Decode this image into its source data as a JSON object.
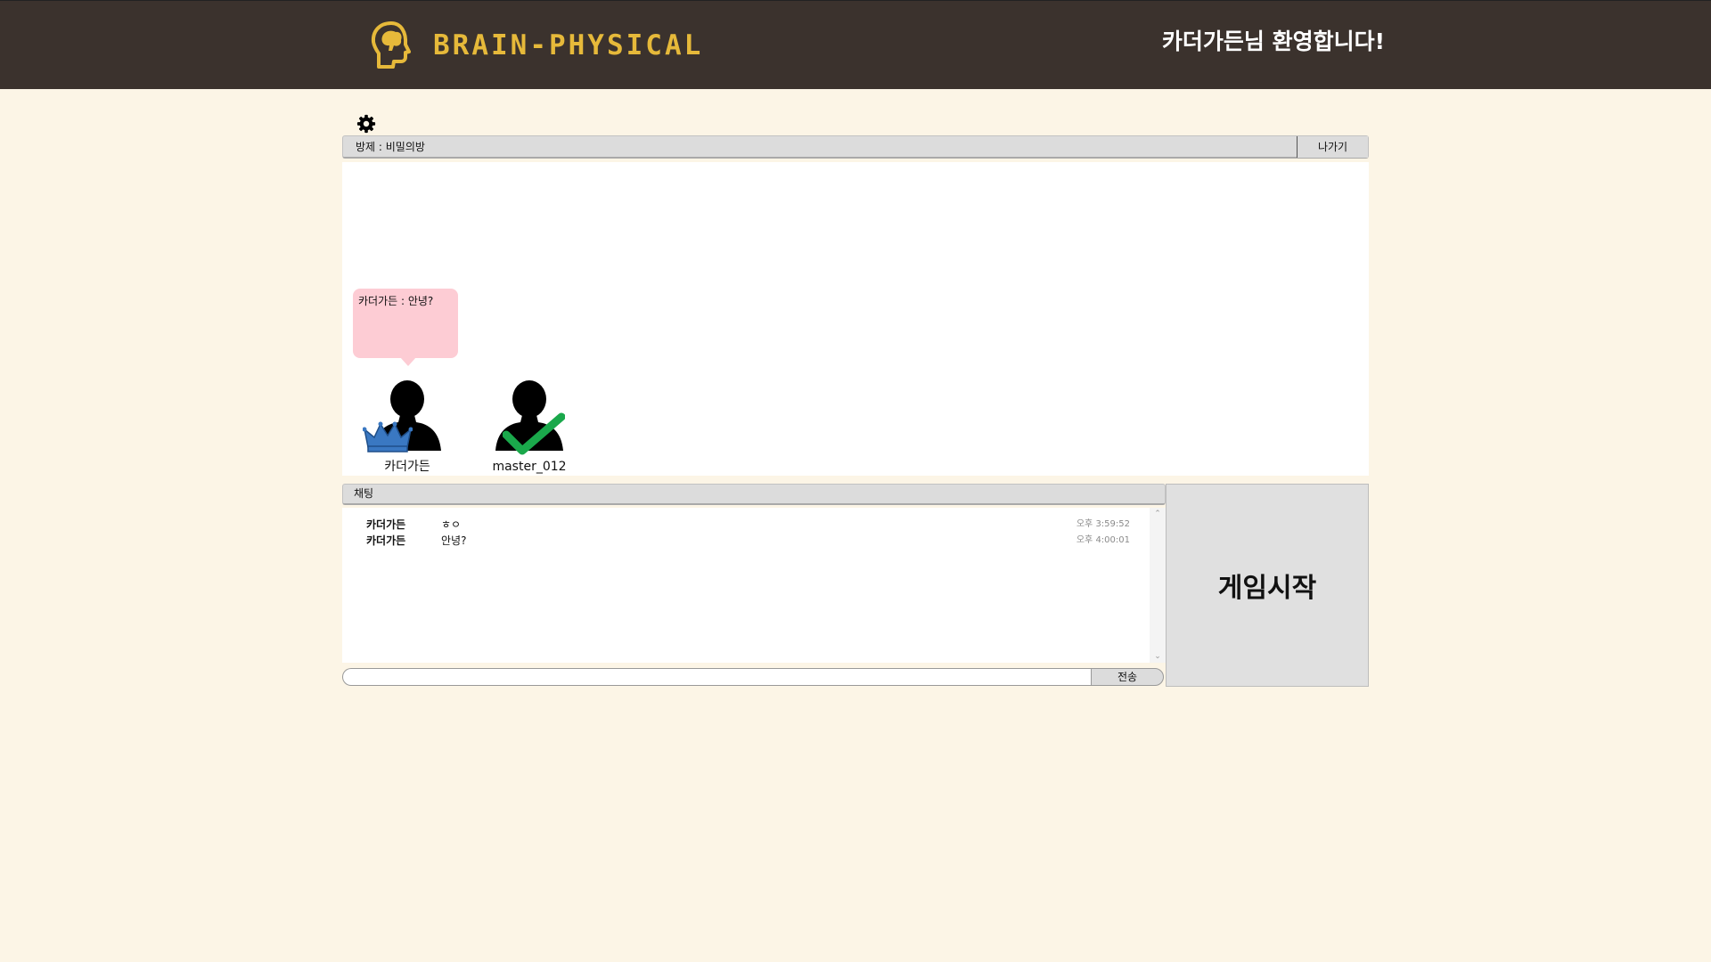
{
  "header": {
    "brand": "BRAIN-PHYSICAL",
    "welcome": "카더가든님 환영합니다!"
  },
  "room": {
    "title": "방제 : 비밀의방",
    "exit_label": "나가기"
  },
  "bubble": {
    "text": "카더가든 : 안녕?"
  },
  "players": [
    {
      "name": "카더가든",
      "badge": "crown-icon"
    },
    {
      "name": "master_012",
      "badge": "checkmark-icon"
    }
  ],
  "chat": {
    "title": "채팅",
    "messages": [
      {
        "sender": "카더가든",
        "text": "ㅎㅇ",
        "time": "오후 3:59:52"
      },
      {
        "sender": "카더가든",
        "text": "안녕?",
        "time": "오후 4:00:01"
      }
    ],
    "input_value": "",
    "send_label": "전송"
  },
  "start": {
    "label": "게임시작"
  },
  "colors": {
    "header_bg": "#3b322d",
    "brand": "#e6b93a",
    "page_bg": "#fcf5e6",
    "bubble": "#fdccd4",
    "crown": "#3a78c2",
    "check": "#1aa84b"
  }
}
